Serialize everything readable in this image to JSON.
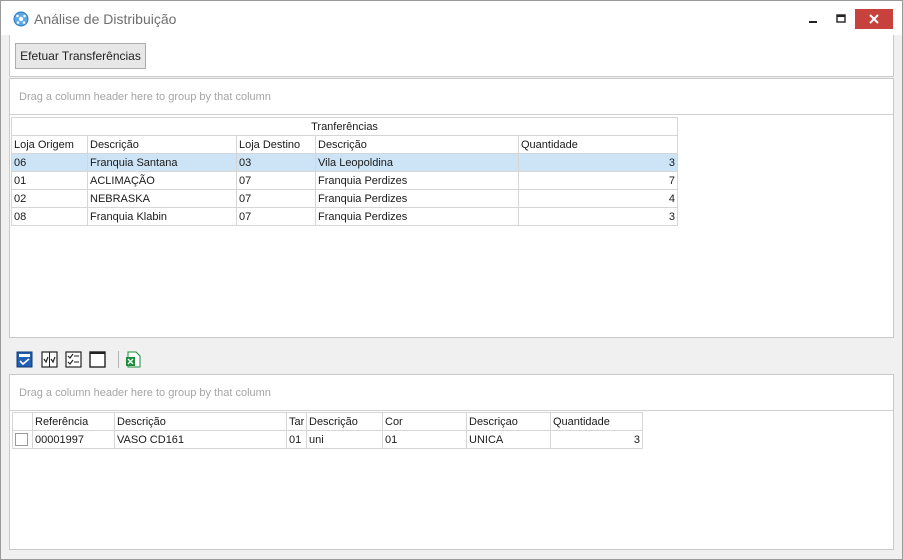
{
  "window": {
    "title": "Análise de Distribuição"
  },
  "toolbar": {
    "transfer_label": "Efetuar Transferências"
  },
  "top_grid": {
    "group_hint": "Drag a column header here to group by that column",
    "band_title": "Tranferências",
    "columns": [
      "Loja Origem",
      "Descrição",
      "Loja Destino",
      "Descrição",
      "Quantidade"
    ],
    "rows": [
      [
        "06",
        "Franquia Santana",
        "03",
        "Vila Leopoldina",
        "3"
      ],
      [
        "01",
        "ACLIMAÇÃO",
        "07",
        "Franquia Perdizes",
        "7"
      ],
      [
        "02",
        "NEBRASKA",
        "07",
        "Franquia Perdizes",
        "4"
      ],
      [
        "08",
        "Franquia Klabin",
        "07",
        "Franquia Perdizes",
        "3"
      ]
    ]
  },
  "bottom_grid": {
    "group_hint": "Drag a column header here to group by that column",
    "columns": [
      "Referência",
      "Descrição",
      "Tar",
      "Descrição",
      "Cor",
      "Descriçao",
      "Quantidade"
    ],
    "rows": [
      [
        "00001997",
        "VASO CD161",
        "01",
        "uni",
        "01",
        "UNICA",
        "3"
      ]
    ]
  },
  "icons": {
    "app": "globe-icon",
    "toolbar": [
      "select-all-icon",
      "check-rows-icon",
      "check-list-icon",
      "clear-selection-icon",
      "excel-export-icon"
    ]
  },
  "colors": {
    "selection": "#cde4f7",
    "close": "#c8423d",
    "accent_blue": "#1f5fb4",
    "excel_green": "#1e8a3c"
  }
}
